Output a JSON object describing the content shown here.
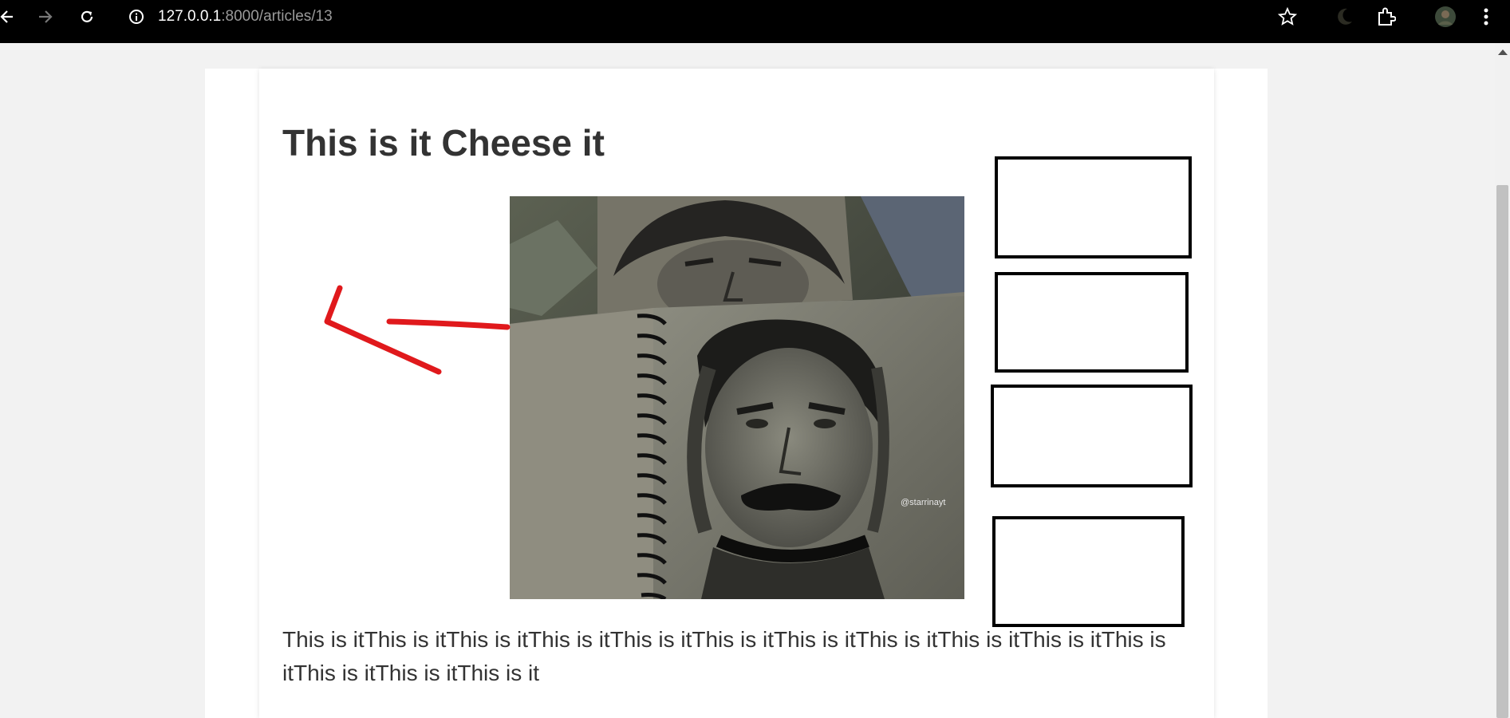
{
  "browser": {
    "url_host": "127.0.0.1",
    "url_path": ":8000/articles/13",
    "icons": [
      "back-arrow-icon",
      "forward-arrow-icon",
      "reload-icon",
      "site-info-icon",
      "bookmark-star-icon",
      "dark-mode-moon-icon",
      "extensions-puzzle-icon",
      "profile-avatar",
      "menu-kebab-icon"
    ]
  },
  "article": {
    "title": "This is it Cheese it",
    "body": "This is itThis is itThis is itThis is itThis is itThis is itThis is itThis is itThis is itThis is itThis is itThis is itThis is itThis is it",
    "image_watermark": "@starrinayt"
  },
  "annotation": {
    "arrow_color": "#e0191c"
  }
}
